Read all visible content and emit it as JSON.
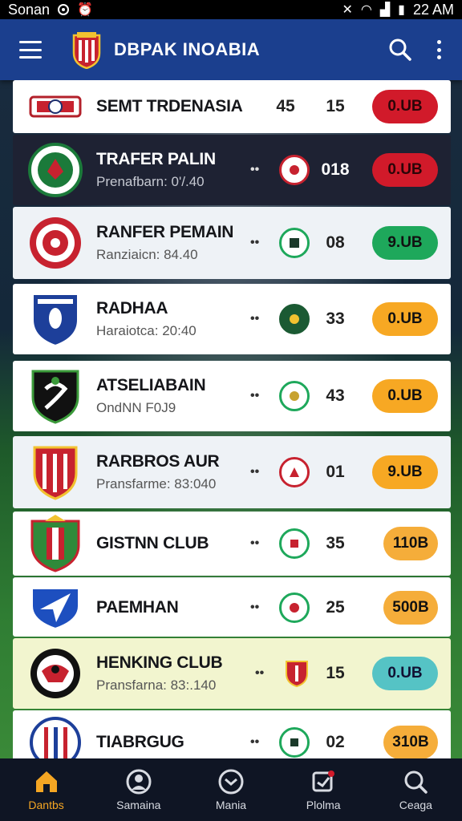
{
  "status_bar": {
    "carrier": "Sonan",
    "time": "22 AM"
  },
  "app_bar": {
    "title": "DBPAK INOABIA"
  },
  "clubs": [
    {
      "name": "SEMT TRDENASIA",
      "sub": "",
      "left_num": "45",
      "num": "15",
      "button": "0.UB"
    },
    {
      "name": "TRAFER PALIN",
      "sub": "Prenafbarn: 0'/.40",
      "num": "018",
      "button": "0.UB"
    },
    {
      "name": "RANFER PEMAIN",
      "sub": "Ranziaicn: 84.40",
      "num": "08",
      "button": "9.UB"
    },
    {
      "name": "RADHAA",
      "sub": "Haraiotca: 20:40",
      "num": "33",
      "button": "0.UB"
    },
    {
      "name": "ATSELIABAIN",
      "sub": "OndNN F0J9",
      "num": "43",
      "button": "0.UB"
    },
    {
      "name": "RARBROS AUR",
      "sub": "Pransfarme: 83:040",
      "num": "01",
      "button": "9.UB"
    },
    {
      "name": "GISTNN CLUB",
      "sub": "",
      "num": "35",
      "button": "110B"
    },
    {
      "name": "PAEMHAN",
      "sub": "",
      "num": "25",
      "button": "500B"
    },
    {
      "name": "HENKING CLUB",
      "sub": "Pransfarna: 83:.140",
      "num": "15",
      "button": "0.UB"
    },
    {
      "name": "TIABRGUG",
      "sub": "",
      "num": "02",
      "button": "310B"
    }
  ],
  "bottom_nav": [
    {
      "label": "Dantbs",
      "icon": "home-icon"
    },
    {
      "label": "Samaina",
      "icon": "profile-icon"
    },
    {
      "label": "Mania",
      "icon": "clock-icon"
    },
    {
      "label": "Plolma",
      "icon": "notification-icon"
    },
    {
      "label": "Ceaga",
      "icon": "search-icon"
    }
  ],
  "colors": {
    "app_bar": "#1b3f8e",
    "active_nav": "#f5a623",
    "pill_red": "#d11a2a",
    "pill_green": "#1ea85b",
    "pill_orange": "#f7a823",
    "pill_teal": "#55c3c5"
  }
}
